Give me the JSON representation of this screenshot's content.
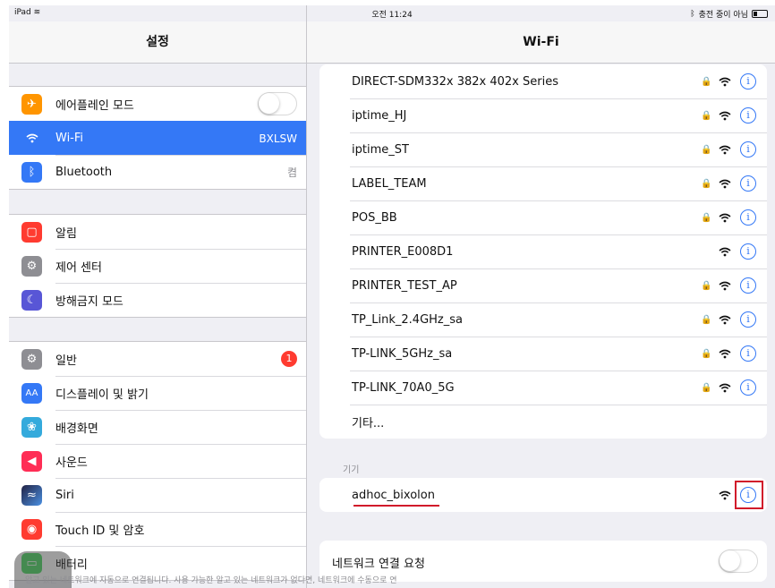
{
  "status_bar": {
    "device": "iPad",
    "time": "오전 11:24",
    "charging": "충전 중이 아님"
  },
  "settings": {
    "title": "설정",
    "groups": [
      [
        {
          "label": "에어플레인 모드",
          "icon": "airplane-icon",
          "color": "#ff9500",
          "control": "toggle"
        },
        {
          "label": "Wi-Fi",
          "icon": "wifi-icon",
          "color": "#3478f6",
          "value": "BXLSW",
          "selected": true
        },
        {
          "label": "Bluetooth",
          "icon": "bluetooth-icon",
          "color": "#3478f6",
          "value": "켬"
        }
      ],
      [
        {
          "label": "알림",
          "icon": "notifications-icon",
          "color": "#ff3b30"
        },
        {
          "label": "제어 센터",
          "icon": "control-center-icon",
          "color": "#8e8e93"
        },
        {
          "label": "방해금지 모드",
          "icon": "moon-icon",
          "color": "#5856d6"
        }
      ],
      [
        {
          "label": "일반",
          "icon": "gear-icon",
          "color": "#8e8e93",
          "badge": "1"
        },
        {
          "label": "디스플레이 및 밝기",
          "icon": "display-icon",
          "color": "#3478f6"
        },
        {
          "label": "배경화면",
          "icon": "wallpaper-icon",
          "color": "#34aadc"
        },
        {
          "label": "사운드",
          "icon": "sound-icon",
          "color": "#ff2d55"
        },
        {
          "label": "Siri",
          "icon": "siri-icon",
          "color": "#222244"
        },
        {
          "label": "Touch ID 및 암호",
          "icon": "fingerprint-icon",
          "color": "#ff3b30"
        },
        {
          "label": "배터리",
          "icon": "battery-icon",
          "color": "#4cd964"
        }
      ]
    ]
  },
  "wifi": {
    "title": "Wi-Fi",
    "networks": [
      {
        "name": "DIRECT-SDM332x 382x 402x Series",
        "locked": true
      },
      {
        "name": "iptime_HJ",
        "locked": true
      },
      {
        "name": "iptime_ST",
        "locked": true
      },
      {
        "name": "LABEL_TEAM",
        "locked": true
      },
      {
        "name": "POS_BB",
        "locked": true
      },
      {
        "name": "PRINTER_E008D1",
        "locked": false
      },
      {
        "name": "PRINTER_TEST_AP",
        "locked": true
      },
      {
        "name": "TP_Link_2.4GHz_sa",
        "locked": true
      },
      {
        "name": "TP-LINK_5GHz_sa",
        "locked": true
      },
      {
        "name": "TP-LINK_70A0_5G",
        "locked": true
      }
    ],
    "other_label": "기타...",
    "devices_header": "기기",
    "devices": [
      {
        "name": "adhoc_bixolon",
        "locked": false
      }
    ],
    "ask_join_label": "네트워크 연결 요청",
    "ask_join_desc": "알고 있는 네트워크에 자동으로 연결됩니다. 사용 가능한 알고 있는 네트워크가 없다면, 네트워크에 수동으로 연",
    "info_glyph": "i",
    "lock_glyph": "🔒"
  },
  "colors": {
    "accent": "#3478f6",
    "highlight": "#d11a2a"
  }
}
